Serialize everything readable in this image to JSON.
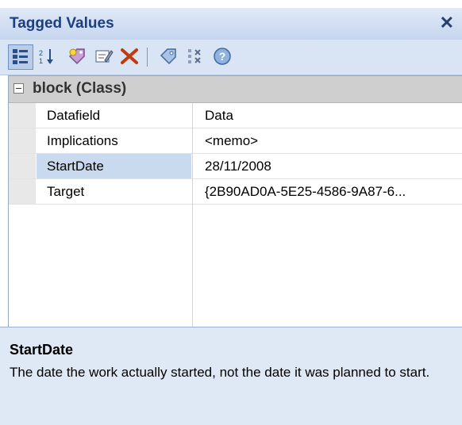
{
  "window": {
    "title": "Tagged Values",
    "close_glyph": "✕"
  },
  "toolbar": {
    "buttons": [
      {
        "name": "categorized-view-icon"
      },
      {
        "name": "sort-alphabetical-icon"
      },
      {
        "name": "new-tag-icon"
      },
      {
        "name": "edit-tag-icon"
      },
      {
        "name": "delete-icon"
      },
      {
        "name": "tag-icon"
      },
      {
        "name": "show-duplicates-icon"
      },
      {
        "name": "help-icon"
      }
    ]
  },
  "grid": {
    "group_label": "block (Class)",
    "rows": [
      {
        "key": "Datafield",
        "value": "Data"
      },
      {
        "key": "Implications",
        "value": "<memo>"
      },
      {
        "key": "StartDate",
        "value": "28/11/2008"
      },
      {
        "key": "Target",
        "value": "{2B90AD0A-5E25-4586-9A87-6..."
      }
    ]
  },
  "description": {
    "title": "StartDate",
    "text": "The date the work actually started, not the date it was planned to start."
  },
  "colors": {
    "accent": "#1b3f7f",
    "selected": "#c9d9ee",
    "group": "#cfcfcf"
  }
}
